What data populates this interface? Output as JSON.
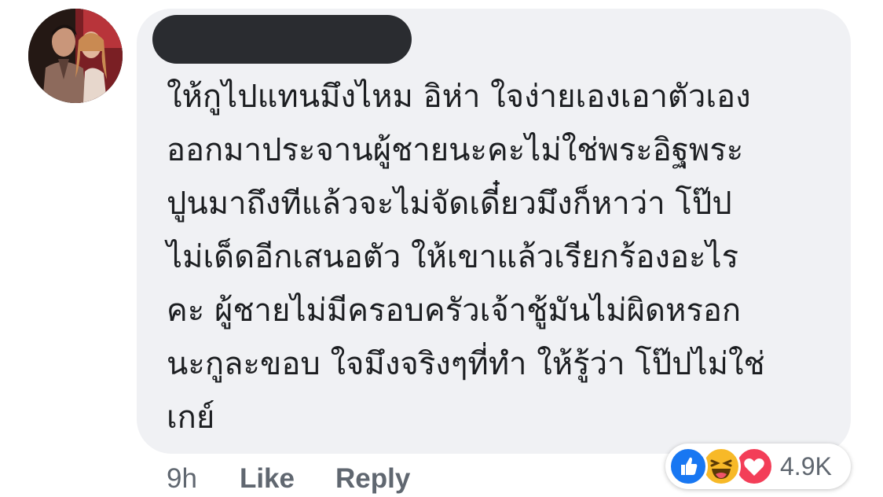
{
  "comment": {
    "author_name": "",
    "text_lines": [
      "ให้กูไปแทนมึงไหม อิห่า ใจง่ายเองเอาตัวเอง",
      "ออกมาประจานผู้ชายนะคะไม่ใช่พระอิฐพระ",
      "ปูนมาถึงทีแล้วจะไม่จัดเดี๋ยวมึงก็หาว่า โป๊ป",
      "ไม่เด็ดอีกเสนอตัว ให้เขาแล้วเรียกร้องอะไร",
      "คะ ผู้ชายไม่มีครอบครัวเจ้าชู้มันไม่ผิดหรอก",
      "นะกูละขอบ ใจมึงจริงๆที่ทำ ให้รู้ว่า โป๊ปไม่ใช่",
      "เกย์"
    ]
  },
  "actions": {
    "time": "9h",
    "like_label": "Like",
    "reply_label": "Reply"
  },
  "reactions": {
    "icons": [
      "like-icon",
      "haha-icon",
      "love-icon"
    ],
    "count": "4.9K",
    "colors": {
      "like": "#1877f2",
      "haha": "#f7b928",
      "love": "#f33e58"
    }
  },
  "colors": {
    "bubble": "#f0f1f4",
    "text": "#1c1e21",
    "meta": "#606770",
    "redaction": "#2a2c30"
  }
}
